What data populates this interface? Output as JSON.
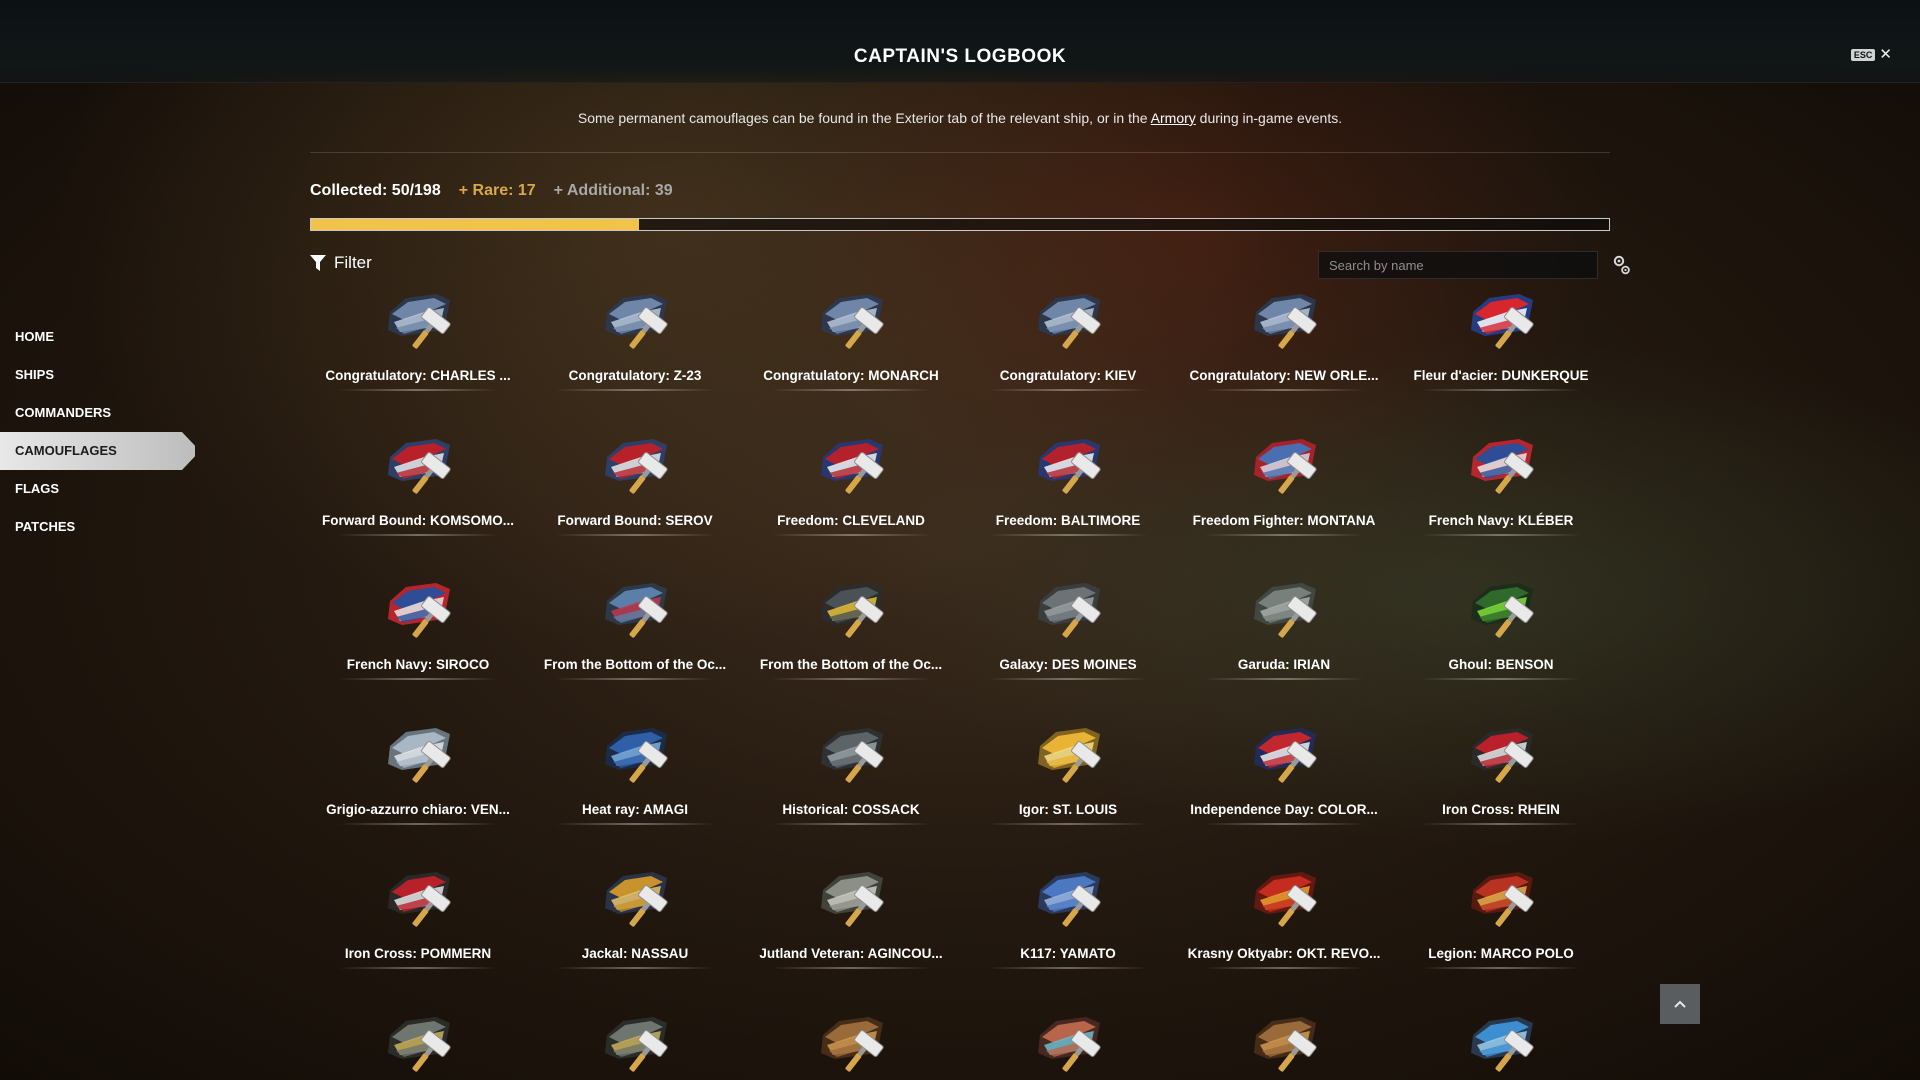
{
  "window": {
    "title": "CAPTAIN'S LOGBOOK",
    "esc_label": "ESC",
    "close_glyph": "✕"
  },
  "sidebar": {
    "items": [
      {
        "label": "HOME",
        "active": false
      },
      {
        "label": "SHIPS",
        "active": false
      },
      {
        "label": "COMMANDERS",
        "active": false
      },
      {
        "label": "CAMOUFLAGES",
        "active": true
      },
      {
        "label": "FLAGS",
        "active": false
      },
      {
        "label": "PATCHES",
        "active": false
      }
    ]
  },
  "notice": {
    "text_before": "Some permanent camouflages can be found in the Exterior tab of the relevant ship, or in the ",
    "link": "Armory",
    "text_after": " during in-game events."
  },
  "stats": {
    "collected": "Collected: 50/198",
    "rare": "+ Rare: 17",
    "additional": "+ Additional: 39"
  },
  "progress": {
    "collected": 50,
    "total": 198,
    "fill_color": "#f2c34b"
  },
  "toolbar": {
    "filter_label": "Filter",
    "filter_icon": "funnel-icon",
    "search_placeholder": "Search by name",
    "settings_icon": "gear-icon"
  },
  "camouflages": [
    {
      "name": "Congratulatory: CHARLES ...",
      "colors": [
        "#6f86a8",
        "#b9c8dc",
        "#2b3a52"
      ]
    },
    {
      "name": "Congratulatory: Z-23",
      "colors": [
        "#6f86a8",
        "#b9c8dc",
        "#2b3a52"
      ]
    },
    {
      "name": "Congratulatory: MONARCH",
      "colors": [
        "#6f86a8",
        "#b9c8dc",
        "#2b3a52"
      ]
    },
    {
      "name": "Congratulatory: KIEV",
      "colors": [
        "#6f86a8",
        "#b9c8dc",
        "#2b3a52"
      ]
    },
    {
      "name": "Congratulatory: NEW ORLE...",
      "colors": [
        "#6f86a8",
        "#b9c8dc",
        "#2b3a52"
      ]
    },
    {
      "name": "Fleur d'acier: DUNKERQUE",
      "colors": [
        "#d7262e",
        "#ffffff",
        "#26408f"
      ]
    },
    {
      "name": "Forward Bound: KOMSOMO...",
      "colors": [
        "#b8202a",
        "#e9e9e9",
        "#2d4170"
      ]
    },
    {
      "name": "Forward Bound: SEROV",
      "colors": [
        "#b8202a",
        "#e9e9e9",
        "#2d4170"
      ]
    },
    {
      "name": "Freedom: CLEVELAND",
      "colors": [
        "#b3222c",
        "#f3f3f3",
        "#27397a"
      ]
    },
    {
      "name": "Freedom: BALTIMORE",
      "colors": [
        "#b3222c",
        "#f3f3f3",
        "#27397a"
      ]
    },
    {
      "name": "Freedom Fighter: MONTANA",
      "colors": [
        "#4a6fb0",
        "#d5dbe6",
        "#b3222c"
      ]
    },
    {
      "name": "French Navy: KLÉBER",
      "colors": [
        "#2e4d96",
        "#e8e8e8",
        "#c62630"
      ]
    },
    {
      "name": "French Navy: SIROCO",
      "colors": [
        "#2e4d96",
        "#e8e8e8",
        "#c62630"
      ]
    },
    {
      "name": "From the Bottom of the Oc...",
      "colors": [
        "#5a7fa8",
        "#c03a4f",
        "#2c3d4e"
      ]
    },
    {
      "name": "From the Bottom of the Oc...",
      "colors": [
        "#4b5256",
        "#e6c23a",
        "#2a2e30"
      ]
    },
    {
      "name": "Galaxy: DES MOINES",
      "colors": [
        "#6d7276",
        "#9ea4a8",
        "#3b3f42"
      ]
    },
    {
      "name": "Garuda: IRIAN",
      "colors": [
        "#77807a",
        "#a9b0aa",
        "#444a46"
      ]
    },
    {
      "name": "Ghoul: BENSON",
      "colors": [
        "#2f6a2c",
        "#7ee03a",
        "#1c2e1a"
      ]
    },
    {
      "name": "Grigio-azzurro chiaro: VEN...",
      "colors": [
        "#a9b7c4",
        "#e4e8ec",
        "#6f7d8a"
      ]
    },
    {
      "name": "Heat ray: AMAGI",
      "colors": [
        "#2f5fa6",
        "#7ab0e6",
        "#1b2d4e"
      ]
    },
    {
      "name": "Historical: COSSACK",
      "colors": [
        "#5c6468",
        "#9aa3a8",
        "#2e3336"
      ]
    },
    {
      "name": "Igor: ST. LOUIS",
      "colors": [
        "#e9b335",
        "#f6e08a",
        "#8a6a22"
      ]
    },
    {
      "name": "Independence Day: COLOR...",
      "colors": [
        "#c2262e",
        "#f0f0f0",
        "#1f2d5e"
      ]
    },
    {
      "name": "Iron Cross: RHEIN",
      "colors": [
        "#b8202a",
        "#e6e6e6",
        "#2b2b2b"
      ]
    },
    {
      "name": "Iron Cross: POMMERN",
      "colors": [
        "#b8202a",
        "#e6e6e6",
        "#2b2b2b"
      ]
    },
    {
      "name": "Jackal: NASSAU",
      "colors": [
        "#c8922c",
        "#e8c66a",
        "#2a3550"
      ]
    },
    {
      "name": "Jutland Veteran: AGINCOU...",
      "colors": [
        "#8c8f86",
        "#cfd0c6",
        "#45473f"
      ]
    },
    {
      "name": "K117: YAMATO",
      "colors": [
        "#4c78c2",
        "#9ab8e8",
        "#2a3e66"
      ]
    },
    {
      "name": "Krasny Oktyabr: OKT. REVO...",
      "colors": [
        "#c42c1f",
        "#f0a22e",
        "#6a1a12"
      ]
    },
    {
      "name": "Legion: MARCO POLO",
      "colors": [
        "#b83222",
        "#e6b04a",
        "#5e1a12"
      ]
    },
    {
      "name": "",
      "colors": [
        "#6f756f",
        "#c9b25a",
        "#2c302c"
      ]
    },
    {
      "name": "",
      "colors": [
        "#6f756f",
        "#c9b25a",
        "#2c302c"
      ]
    },
    {
      "name": "",
      "colors": [
        "#9a6a3a",
        "#d29a52",
        "#4a301a"
      ]
    },
    {
      "name": "",
      "colors": [
        "#b8654a",
        "#6fbcd0",
        "#4a2a22"
      ]
    },
    {
      "name": "",
      "colors": [
        "#9a6a3a",
        "#d29a52",
        "#4a301a"
      ]
    },
    {
      "name": "",
      "colors": [
        "#3d8ed0",
        "#9ad0f0",
        "#2a3e56"
      ]
    }
  ],
  "scroll_top": {
    "icon": "chevron-up-icon"
  }
}
